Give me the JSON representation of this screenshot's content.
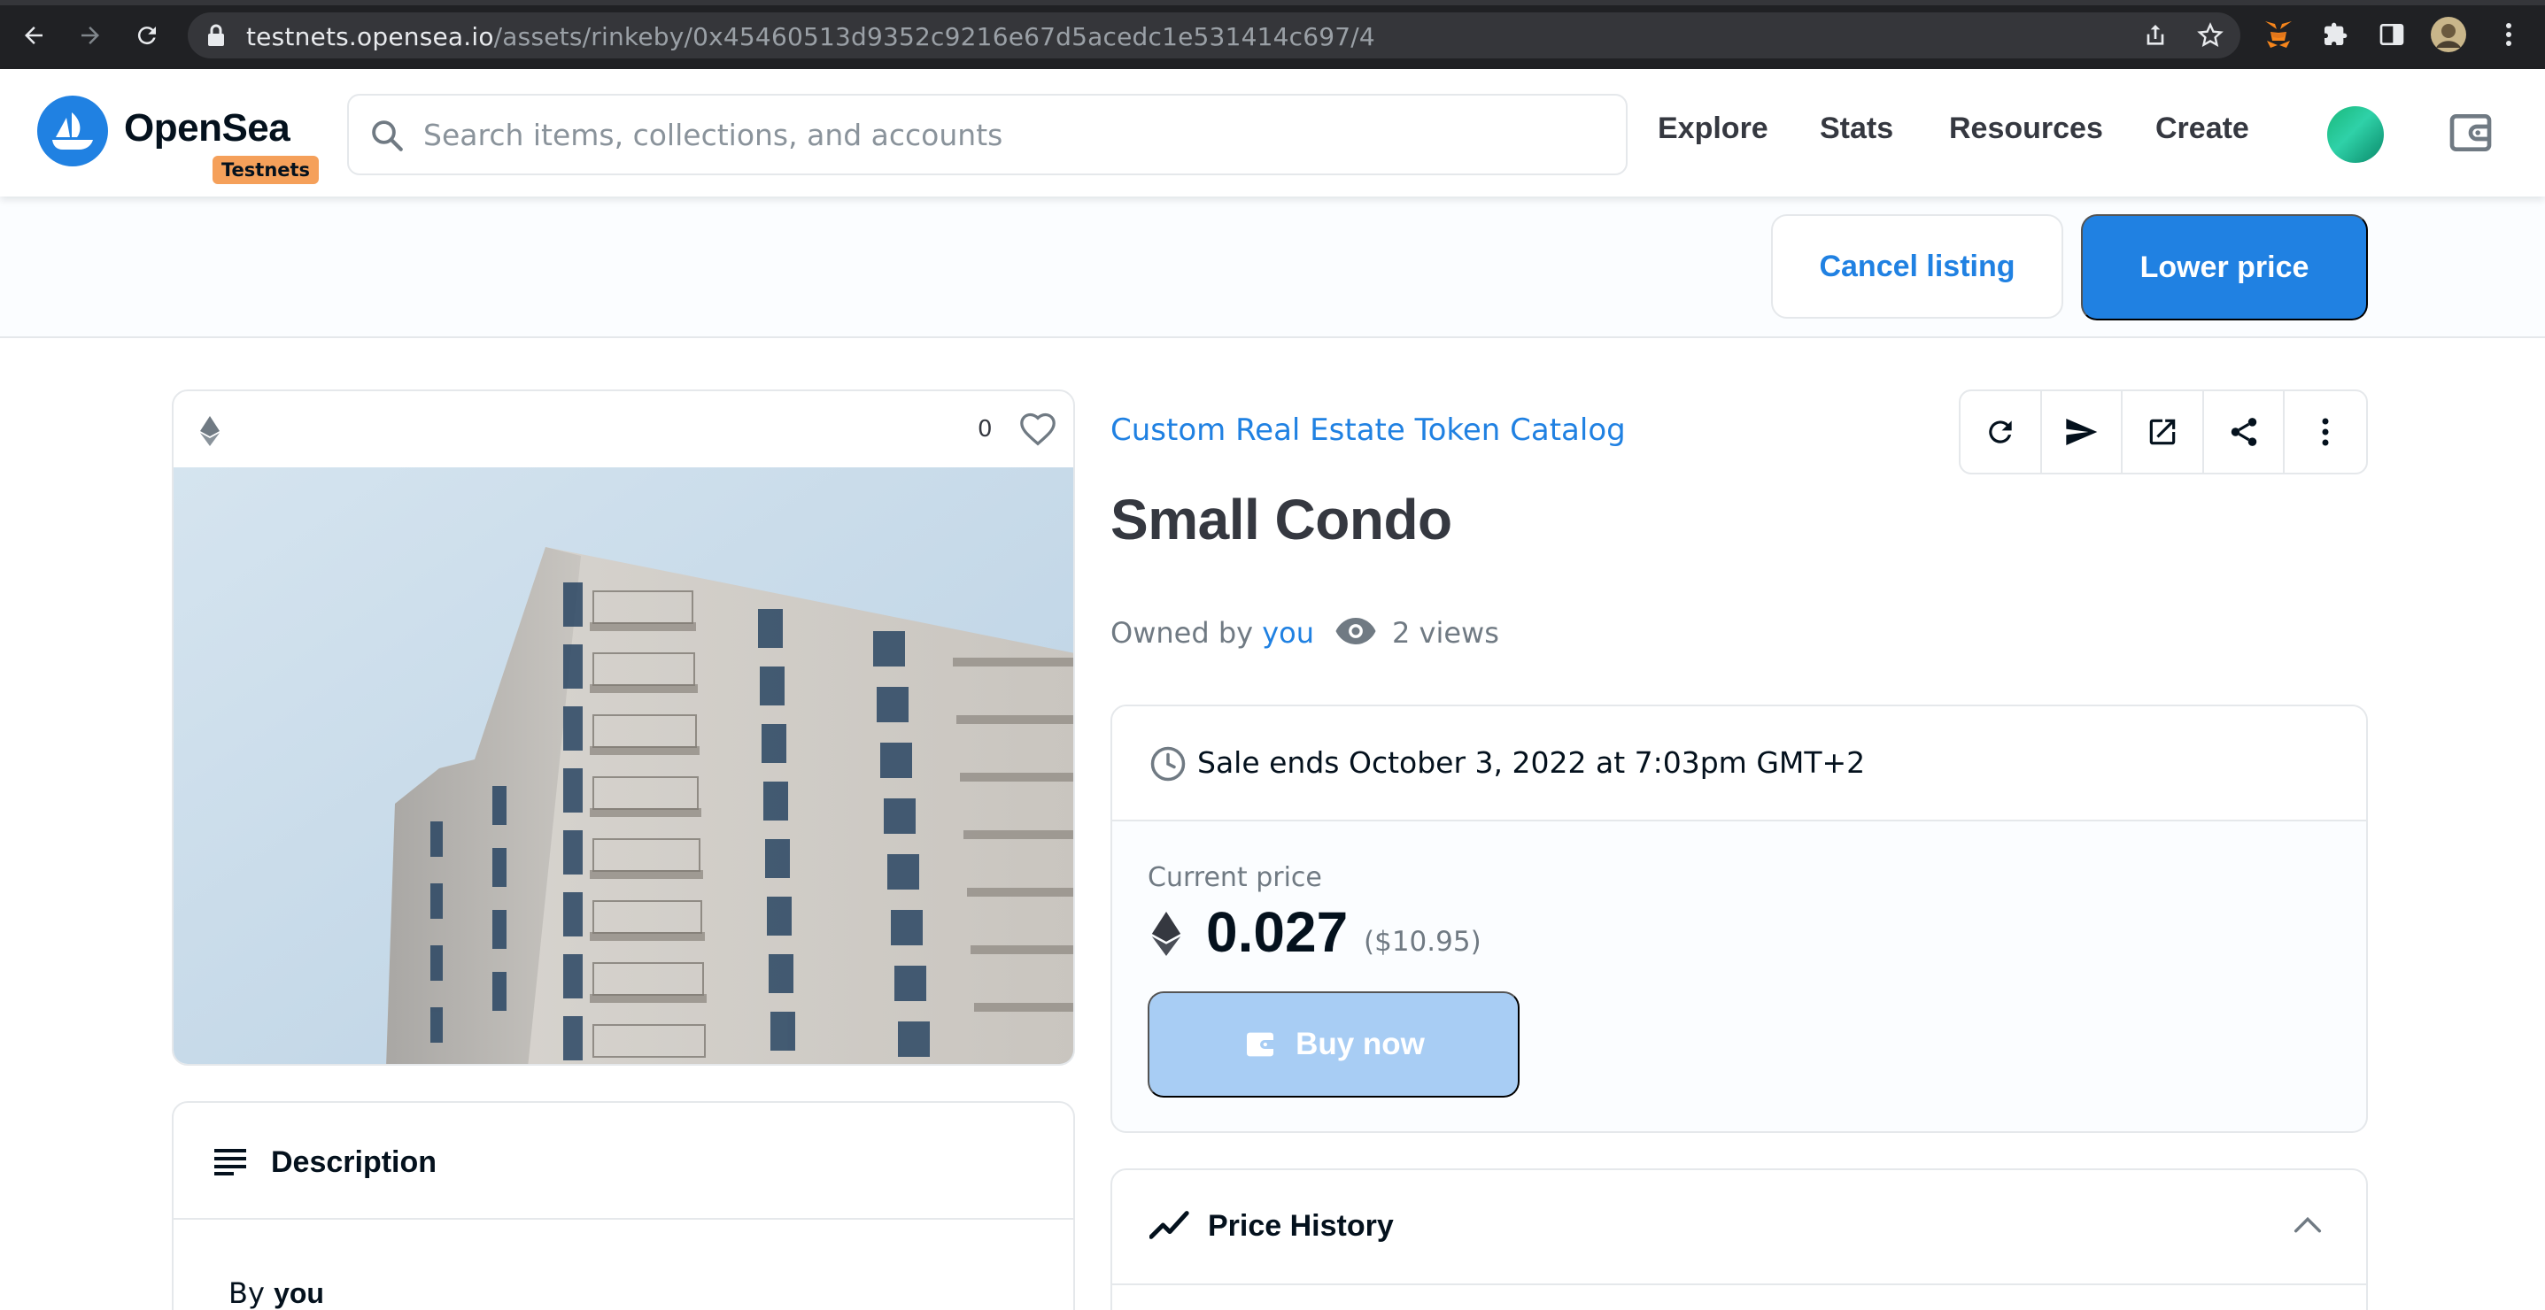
{
  "browser": {
    "url_host": "testnets.opensea.io",
    "url_path": "/assets/rinkeby/0x45460513d9352c9216e67d5acedc1e531414c697/4"
  },
  "header": {
    "brand": "OpenSea",
    "badge": "Testnets",
    "search_placeholder": "Search items, collections, and accounts",
    "nav": [
      {
        "label": "Explore"
      },
      {
        "label": "Stats"
      },
      {
        "label": "Resources"
      },
      {
        "label": "Create"
      }
    ]
  },
  "action_bar": {
    "cancel_label": "Cancel listing",
    "lower_label": "Lower price"
  },
  "media": {
    "favorites_count": "0"
  },
  "item": {
    "collection": "Custom Real Estate Token Catalog",
    "name": "Small Condo",
    "owned_by_prefix": "Owned by",
    "owner": "you",
    "views": "2 views"
  },
  "sale": {
    "ends": "Sale ends October 3, 2022 at 7:03pm GMT+2",
    "current_price_label": "Current price",
    "price": "0.027",
    "usd": "($10.95)",
    "buy_label": "Buy now"
  },
  "description": {
    "title": "Description",
    "by_prefix": "By",
    "by_owner": "you"
  },
  "price_history": {
    "title": "Price History"
  },
  "colors": {
    "accent": "#2081e2",
    "badge": "#f5a05a",
    "buy_disabled": "#a8cdf4"
  }
}
